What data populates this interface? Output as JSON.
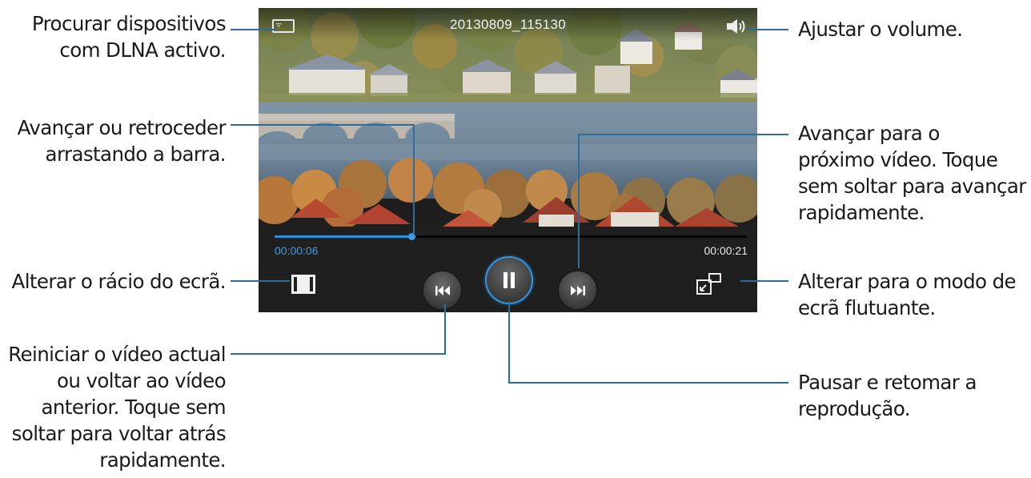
{
  "player": {
    "filename": "20130809_115130",
    "elapsed": "00:00:06",
    "total": "00:00:21",
    "progress_fraction": 0.29,
    "icons": {
      "dlna": "dlna-screen-icon",
      "volume": "speaker-icon",
      "ratio": "screen-ratio-icon",
      "prev": "rewind-icon",
      "pause": "pause-icon",
      "next": "fast-forward-icon",
      "popup": "popup-window-icon"
    },
    "colors": {
      "accent": "#2e8fd8",
      "controls_bg": "#1f1f1f"
    }
  },
  "callouts": {
    "dlna": [
      "Procurar dispositivos",
      "com DLNA activo."
    ],
    "seek": [
      "Avançar ou retroceder",
      "arrastando a barra."
    ],
    "ratio": [
      "Alterar o rácio do ecrã."
    ],
    "prev": [
      "Reiniciar o vídeo actual",
      "ou voltar ao vídeo",
      "anterior. Toque sem",
      "soltar para voltar atrás",
      "rapidamente."
    ],
    "volume": [
      "Ajustar o volume."
    ],
    "next": [
      "Avançar para o",
      "próximo vídeo. Toque",
      "sem soltar para avançar",
      "rapidamente."
    ],
    "popup": [
      "Alterar para o modo de",
      "ecrã flutuante."
    ],
    "pause": [
      "Pausar e retomar a",
      "reprodução."
    ]
  }
}
